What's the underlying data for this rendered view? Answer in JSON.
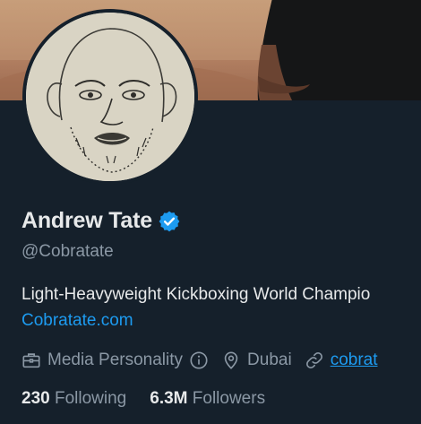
{
  "profile": {
    "name": "Andrew Tate",
    "handle": "@Cobratate",
    "bio": "Light-Heavyweight Kickboxing World Champio",
    "website_link": "Cobratate.com",
    "category": "Media Personality",
    "location": "Dubai",
    "url_partial": "cobrat",
    "following_count": "230",
    "following_label": "Following",
    "followers_count": "6.3M",
    "followers_label": "Followers"
  },
  "icons": {
    "verified": "verified-badge-icon",
    "category": "briefcase-icon",
    "info": "info-icon",
    "location": "map-pin-icon",
    "link": "link-icon"
  },
  "colors": {
    "background": "#15202b",
    "accent": "#1d9bf0",
    "text_primary": "#e7e9ea",
    "text_secondary": "#8b98a5"
  }
}
